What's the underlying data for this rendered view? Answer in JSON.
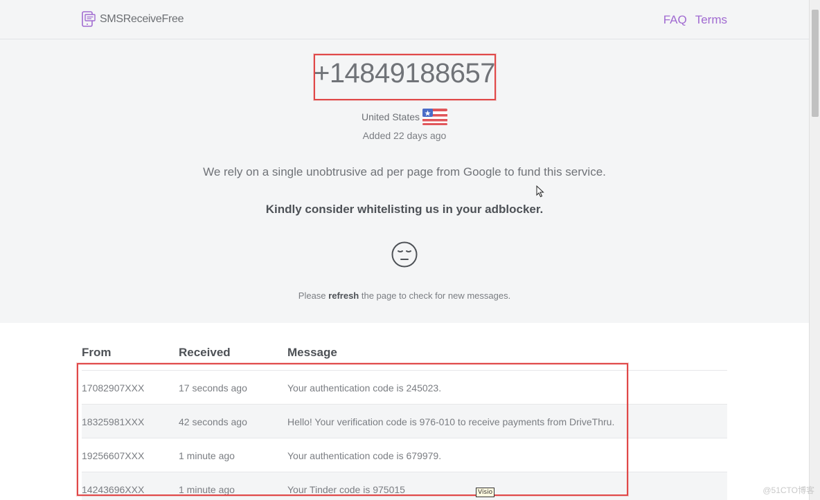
{
  "navbar": {
    "brand": "SMSReceiveFree",
    "links": [
      "FAQ",
      "Terms"
    ]
  },
  "hero": {
    "number": "+14849188657",
    "country": "United States",
    "added": "Added 22 days ago",
    "ad_note": "We rely on a single unobtrusive ad per page from Google to fund this service.",
    "whitelist": "Kindly consider whitelisting us in your adblocker.",
    "refresh_prefix": "Please ",
    "refresh_bold": "refresh",
    "refresh_suffix": " the page to check for new messages."
  },
  "table": {
    "headers": [
      "From",
      "Received",
      "Message"
    ],
    "rows": [
      {
        "from": "17082907XXX",
        "received": "17 seconds ago",
        "message": "Your authentication code is 245023."
      },
      {
        "from": "18325981XXX",
        "received": "42 seconds ago",
        "message": "Hello! Your verification code is 976-010 to receive payments from DriveThru."
      },
      {
        "from": "19256607XXX",
        "received": "1 minute ago",
        "message": "Your authentication code is 679979."
      },
      {
        "from": "14243696XXX",
        "received": "1 minute ago",
        "message": "Your Tinder code is 975015"
      }
    ]
  },
  "overlay": {
    "tooltip": "Visio",
    "watermark": "@51CTO博客"
  },
  "colors": {
    "accent": "#a06ad1",
    "highlight_border": "#e04848",
    "panel_bg": "#f4f5f6"
  }
}
